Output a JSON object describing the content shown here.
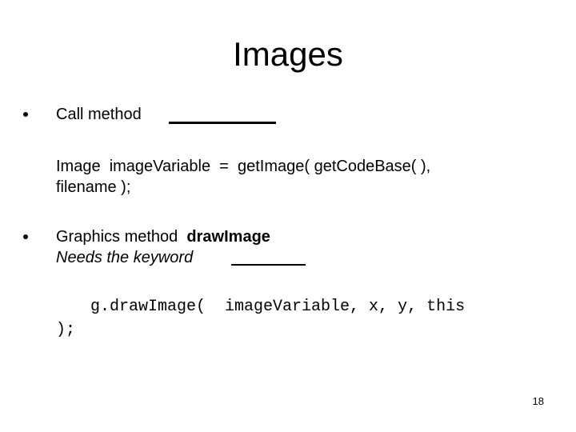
{
  "slide": {
    "title": "Images",
    "bullets": [
      {
        "text": "Call method",
        "blank": "__________"
      },
      {
        "text": "Graphics method",
        "bold_text": "drawImage",
        "italic_line": "Needs the keyword",
        "blank": "_______"
      }
    ],
    "code_block_1": {
      "line1": "Image  imageVariable  =  getImage( getCodeBase( ),",
      "line2": "filename );"
    },
    "code_block_2": {
      "line1": "g.drawImage(  imageVariable, x, y, this",
      "line2": ");"
    },
    "page_number": "18"
  }
}
